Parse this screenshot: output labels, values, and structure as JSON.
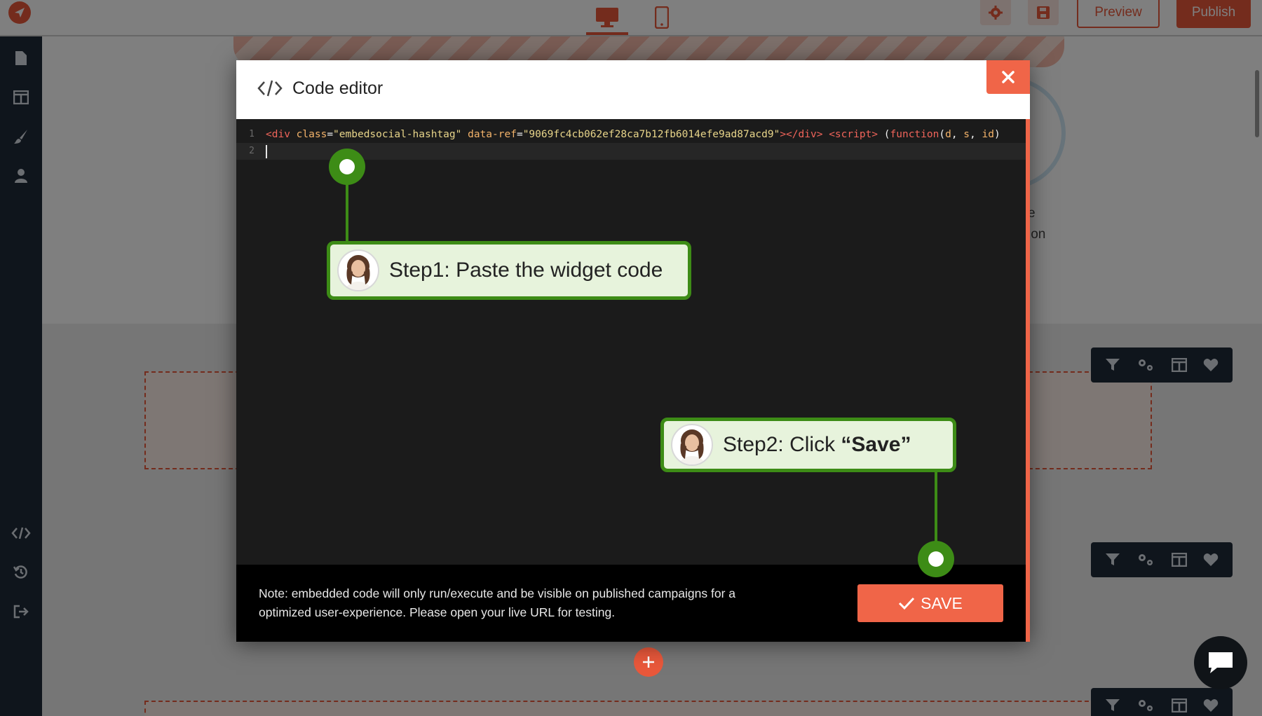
{
  "topbar": {
    "preview_label": "Preview",
    "publish_label": "Publish"
  },
  "canvas": {
    "peek_text_1": "e",
    "peek_text_2": "ion"
  },
  "modal": {
    "title": "Code editor",
    "code": {
      "line_numbers": [
        "1",
        "2"
      ],
      "tokens": [
        {
          "t": "<div ",
          "c": "t-tag"
        },
        {
          "t": "class",
          "c": "t-attr"
        },
        {
          "t": "=",
          "c": "t-plain"
        },
        {
          "t": "\"embedsocial-hashtag\"",
          "c": "t-str"
        },
        {
          "t": " data-ref",
          "c": "t-attr"
        },
        {
          "t": "=",
          "c": "t-plain"
        },
        {
          "t": "\"9069fc4cb062ef28ca7b12fb6014efe9ad87acd9\"",
          "c": "t-str"
        },
        {
          "t": "></div> ",
          "c": "t-tag"
        },
        {
          "t": "<script> ",
          "c": "t-tag"
        },
        {
          "t": "(",
          "c": "t-plain"
        },
        {
          "t": "function",
          "c": "t-kw"
        },
        {
          "t": "(",
          "c": "t-plain"
        },
        {
          "t": "d",
          "c": "t-attr"
        },
        {
          "t": ", ",
          "c": "t-plain"
        },
        {
          "t": "s",
          "c": "t-attr"
        },
        {
          "t": ", ",
          "c": "t-plain"
        },
        {
          "t": "id",
          "c": "t-attr"
        },
        {
          "t": ")",
          "c": "t-plain"
        }
      ]
    },
    "note": "Note: embedded code will only run/execute and be visible on published campaigns for a optimized user-experience. Please open your live URL for testing.",
    "save_label": "SAVE"
  },
  "steps": {
    "step1": "Step1: Paste the widget code",
    "step2_prefix": "Step2: Click ",
    "step2_bold": "“Save”"
  },
  "colors": {
    "accent": "#e9583b",
    "callout_green": "#3d8c16",
    "callout_bg": "#e7f3dc",
    "sidebar": "#1f2a38"
  }
}
